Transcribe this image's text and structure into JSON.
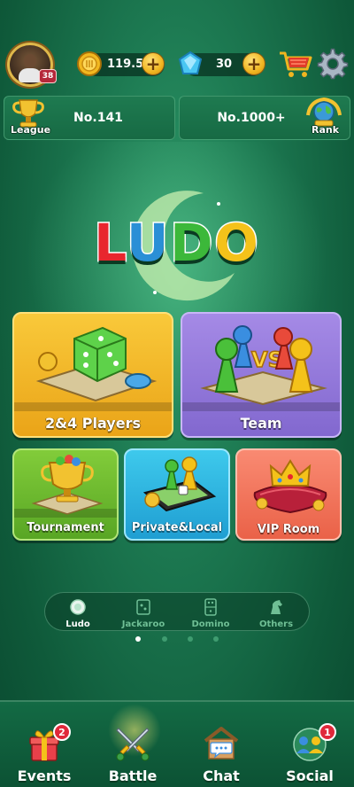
{
  "profile": {
    "level": "38"
  },
  "currencies": {
    "coins": {
      "value": "119.5K",
      "icon": "gold-coin-icon"
    },
    "gems": {
      "value": "30",
      "icon": "blue-gem-icon"
    }
  },
  "rank_bar": {
    "league": {
      "label": "League",
      "value": "No.141"
    },
    "world": {
      "label": "Rank",
      "value": "No.1000+"
    }
  },
  "logo": {
    "letters": [
      "L",
      "U",
      "D",
      "O"
    ],
    "colors": [
      "#e8262e",
      "#2a8fd6",
      "#3cb83a",
      "#f4c21a"
    ]
  },
  "modes": [
    {
      "label": "2&4 Players",
      "color": "yellow"
    },
    {
      "label": "Team",
      "color": "purple"
    },
    {
      "label": "Tournament",
      "color": "green"
    },
    {
      "label": "Private&Local",
      "color": "cyan"
    },
    {
      "label": "VIP Room",
      "color": "red"
    }
  ],
  "categories": [
    {
      "label": "Ludo",
      "active": true
    },
    {
      "label": "Jackaroo",
      "active": false
    },
    {
      "label": "Domino",
      "active": false
    },
    {
      "label": "Others",
      "active": false
    }
  ],
  "pager": {
    "active_page": 1,
    "total_pages": 4
  },
  "nav": [
    {
      "label": "Events",
      "badge": "2"
    },
    {
      "label": "Battle",
      "badge": ""
    },
    {
      "label": "Chat",
      "badge": ""
    },
    {
      "label": "Social",
      "badge": "1"
    }
  ]
}
